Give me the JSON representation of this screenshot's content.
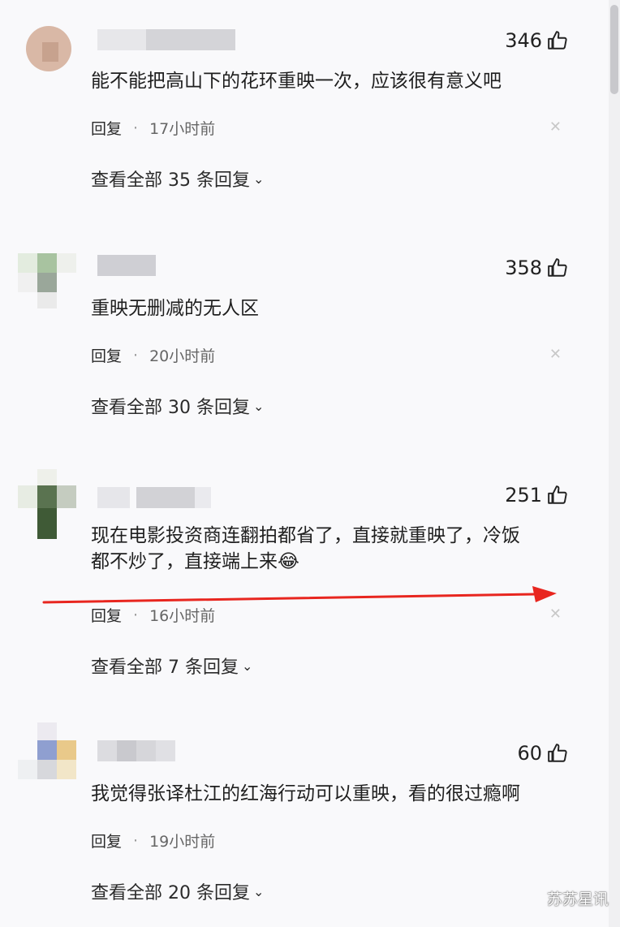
{
  "comments": [
    {
      "likes": "346",
      "text": "能不能把高山下的花环重映一次，应该很有意义吧",
      "reply_label": "回复",
      "separator": "·",
      "time": "17小时前",
      "view_all": "查看全部 35 条回复"
    },
    {
      "likes": "358",
      "text": "重映无删减的无人区",
      "reply_label": "回复",
      "separator": "·",
      "time": "20小时前",
      "view_all": "查看全部 30 条回复"
    },
    {
      "likes": "251",
      "text_line1": "现在电影投资商连翻拍都省了，直接就重映了，冷饭",
      "text_line2": "都不炒了，直接端上来",
      "emoji": "😂",
      "reply_label": "回复",
      "separator": "·",
      "time": "16小时前",
      "view_all": "查看全部 7 条回复"
    },
    {
      "likes": "60",
      "text": "我觉得张译杜江的红海行动可以重映，看的很过瘾啊",
      "reply_label": "回复",
      "separator": "·",
      "time": "19小时前",
      "view_all": "查看全部 20 条回复"
    }
  ],
  "icons": {
    "like": "thumbs-up-icon",
    "close": "close-icon",
    "chevron": "chevron-down-icon"
  },
  "colors": {
    "arrow": "#e8261f",
    "text": "#1f1f1f",
    "meta": "#666666"
  },
  "watermark": "苏苏星讯"
}
